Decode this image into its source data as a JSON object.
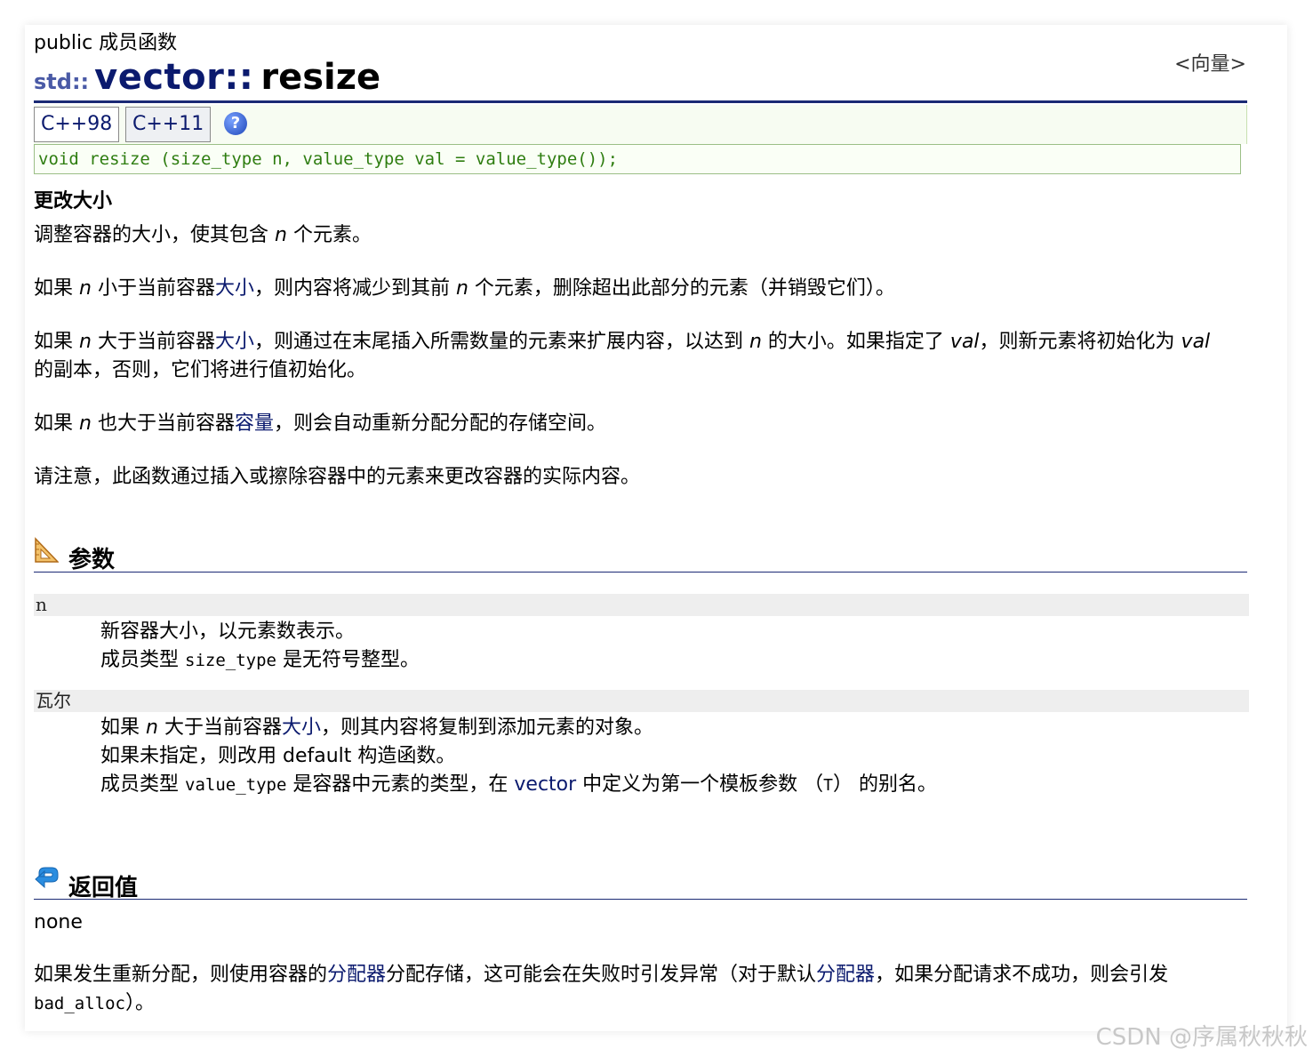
{
  "header": {
    "kind": "public 成员函数",
    "namespace": "std::",
    "class_name": "vector::",
    "function_name": "resize",
    "container_link": "<向量>"
  },
  "tabs": [
    {
      "label": "C++98"
    },
    {
      "label": "C++11"
    }
  ],
  "help_icon": "question-icon",
  "declaration": "void resize (size_type n, value_type val = value_type());",
  "description": {
    "title": "更改大小",
    "p1": {
      "a": "调整容器的大小，使其包含 ",
      "n": "n",
      "b": " 个元素。"
    },
    "p2": {
      "a": "如果 ",
      "n1": "n",
      "b": " 小于当前容器",
      "link": "大小",
      "c": "，则内容将减少到其前 ",
      "n2": "n",
      "d": " 个元素，删除超出此部分的元素（并销毁它们）。"
    },
    "p3": {
      "a": "如果 ",
      "n": "n",
      "b": " 大于当前容器",
      "link": "大小",
      "c": "，则通过在末尾插入所需数量的元素来扩展内容，以达到 ",
      "n2": "n",
      "d": " 的大小。如果指定了 ",
      "val1": "val",
      "e": "，则新元素将初始化为 ",
      "val2": "val",
      "line2": "的副本，否则，它们将进行值初始化。"
    },
    "p4": {
      "a": "如果 ",
      "n": "n",
      "b": " 也大于当前容器",
      "link": "容量",
      "c": "，则会自动重新分配分配的存储空间。"
    },
    "p5": "请注意，此函数通过插入或擦除容器中的元素来更改容器的实际内容。"
  },
  "parameters": {
    "title": "参数",
    "items": [
      {
        "name": "n",
        "line1": "新容器大小，以元素数表示。",
        "line2": {
          "a": "成员类型 ",
          "code": "size_type",
          "b": " 是无符号整型。"
        }
      },
      {
        "name": "瓦尔",
        "line1": {
          "a": "如果 ",
          "n": "n",
          "b": " 大于当前容器",
          "link": "大小",
          "c": "，则其内容将复制到添加元素的对象。"
        },
        "line2": "如果未指定，则改用 default 构造函数。",
        "line3": {
          "a": "成员类型 ",
          "code": "value_type",
          "b": " 是容器中元素的类型，在 ",
          "link": "vector",
          "c": " 中定义为第一个模板参数 （",
          "t": "T",
          "d": "） 的别名。"
        }
      }
    ]
  },
  "return_value": {
    "title": "返回值",
    "value": "none",
    "p1": {
      "a": "如果发生重新分配，则使用容器的",
      "link1": "分配器",
      "b": "分配存储，这可能会在失败时引发异常（对于默认",
      "link2": "分配器",
      "c": "，如果分配请求不成功，则会引发"
    },
    "p2": {
      "code": "bad_alloc",
      "b": "）。"
    }
  },
  "watermark": "CSDN @序属秋秋秋",
  "colors": {
    "title_blue": "#0b1a6e",
    "namespace_blue": "#4a5aa6",
    "declaration_green": "#2e7d10",
    "tab_bar_bg": "#f7fcf2",
    "param_bar_bg": "#eeeeee"
  }
}
